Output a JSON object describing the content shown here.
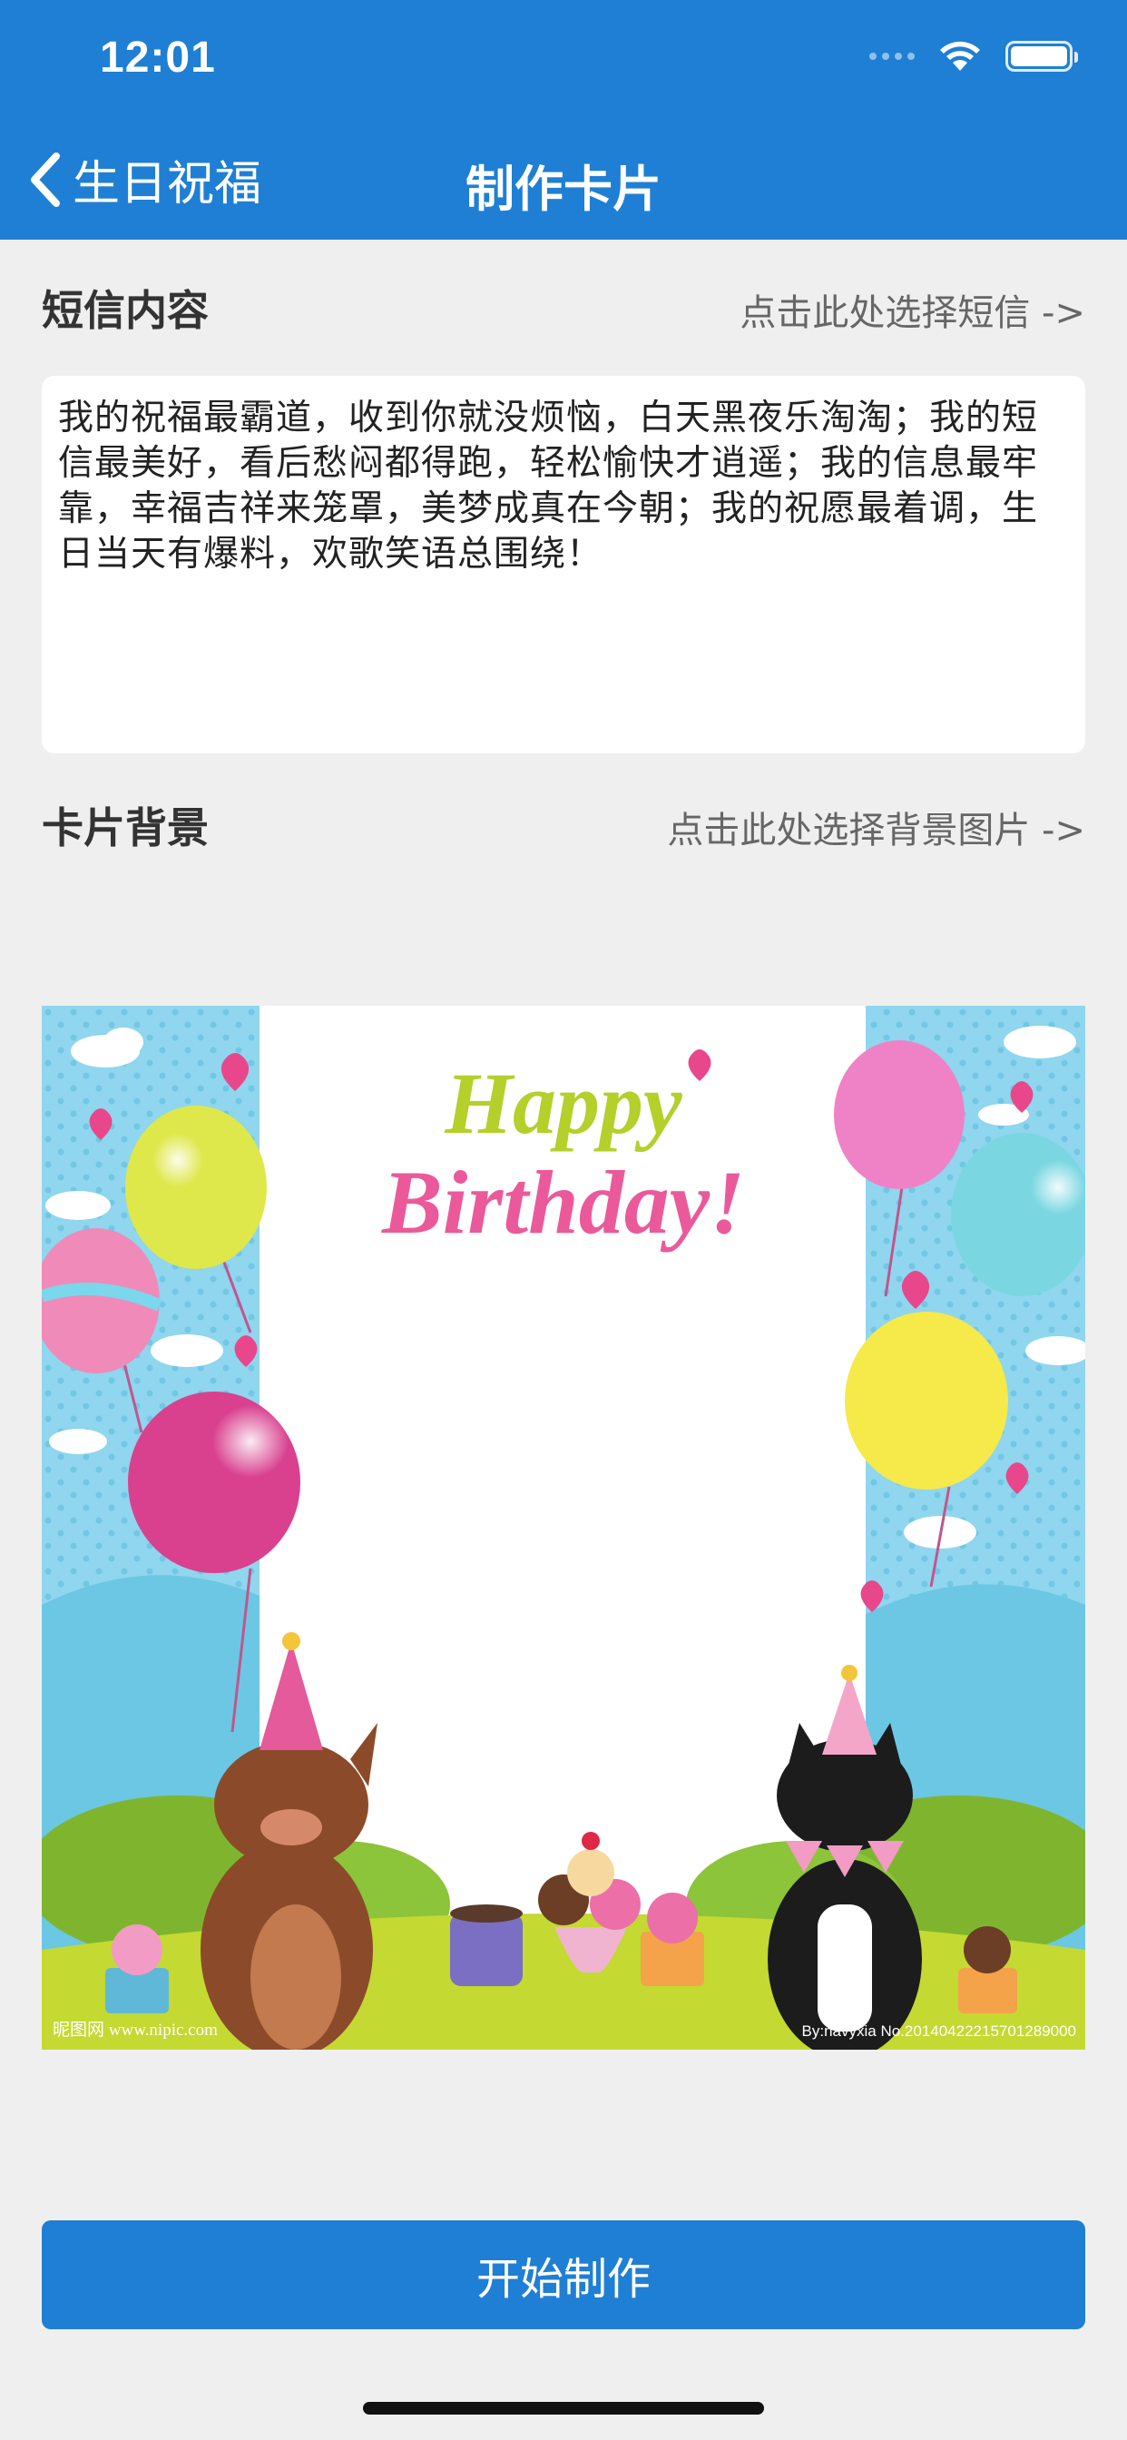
{
  "status_bar": {
    "time": "12:01"
  },
  "nav": {
    "back_label": "生日祝福",
    "title": "制作卡片"
  },
  "sms_section": {
    "title": "短信内容",
    "action": "点击此处选择短信 ->",
    "content": "我的祝福最霸道，收到你就没烦恼，白天黑夜乐淘淘；我的短信最美好，看后愁闷都得跑，轻松愉快才逍遥；我的信息最牢靠，幸福吉祥来笼罩，美梦成真在今朝；我的祝愿最着调，生日当天有爆料，欢歌笑语总围绕！"
  },
  "background_section": {
    "title": "卡片背景",
    "action": "点击此处选择背景图片 ->"
  },
  "card_image": {
    "headline_1": "Happy",
    "headline_2": "Birthday!",
    "watermark_left": "昵图网 www.nipic.com",
    "watermark_right": "By:navyxia  No.20140422215701289000"
  },
  "start_button": {
    "label": "开始制作"
  },
  "colors": {
    "primary": "#1f7fd4",
    "background": "#efefef",
    "card_sky": "#8fd6ee",
    "grass": "#b9d43a"
  }
}
